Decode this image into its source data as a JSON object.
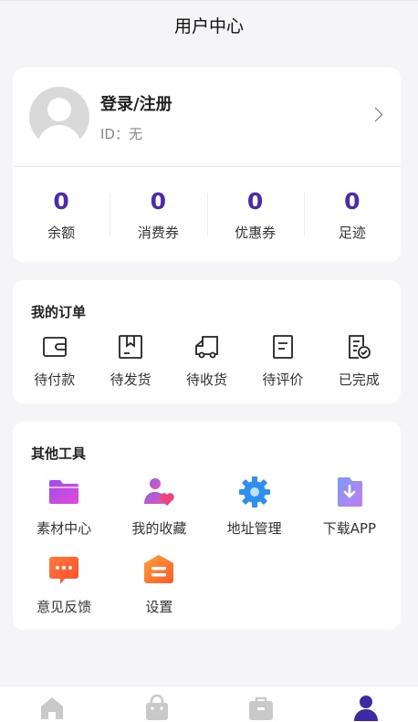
{
  "header": {
    "title": "用户中心"
  },
  "user": {
    "name": "登录/注册",
    "id_text": "ID：无"
  },
  "stats": [
    {
      "value": "0",
      "label": "余额"
    },
    {
      "value": "0",
      "label": "消费券"
    },
    {
      "value": "0",
      "label": "优惠券"
    },
    {
      "value": "0",
      "label": "足迹"
    }
  ],
  "orders": {
    "title": "我的订单",
    "items": [
      {
        "label": "待付款",
        "icon": "wallet-icon"
      },
      {
        "label": "待发货",
        "icon": "box-icon"
      },
      {
        "label": "待收货",
        "icon": "truck-icon"
      },
      {
        "label": "待评价",
        "icon": "note-icon"
      },
      {
        "label": "已完成",
        "icon": "checklist-icon"
      }
    ]
  },
  "tools": {
    "title": "其他工具",
    "items": [
      {
        "label": "素材中心",
        "icon": "folder-icon"
      },
      {
        "label": "我的收藏",
        "icon": "favorite-user-icon"
      },
      {
        "label": "地址管理",
        "icon": "gear-icon"
      },
      {
        "label": "下载APP",
        "icon": "download-file-icon"
      },
      {
        "label": "意见反馈",
        "icon": "chat-bubble-icon"
      },
      {
        "label": "设置",
        "icon": "settings-box-icon"
      }
    ]
  },
  "tabbar": {
    "tabs": [
      {
        "icon": "home-icon"
      },
      {
        "icon": "shopping-bag-icon"
      },
      {
        "icon": "briefcase-icon"
      },
      {
        "icon": "user-icon",
        "active": true
      }
    ],
    "colors": {
      "inactive": "#c9c9c9",
      "active": "#3f2aa6"
    }
  },
  "colors": {
    "accent": "#4a2bb0",
    "background": "#f5f5f7"
  }
}
